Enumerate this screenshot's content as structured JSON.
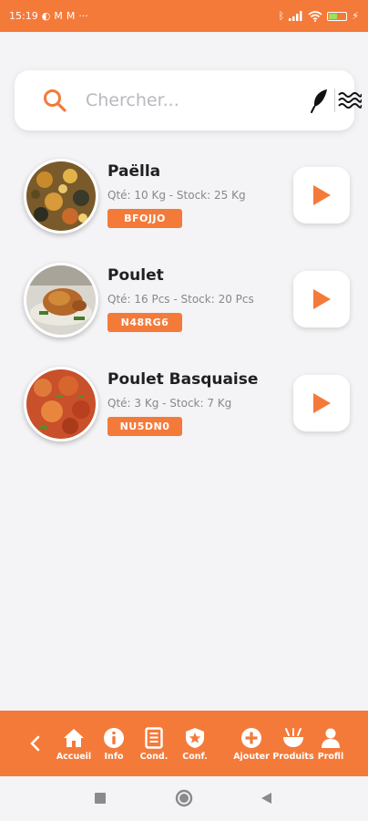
{
  "status_bar": {
    "time": "15:19",
    "dots": "···"
  },
  "search": {
    "placeholder": "Chercher..."
  },
  "products": [
    {
      "name": "Paëlla",
      "meta": "Qté: 10 Kg - Stock: 25 Kg",
      "code": "BFOJJO"
    },
    {
      "name": "Poulet",
      "meta": "Qté: 16 Pcs - Stock: 20 Pcs",
      "code": "N48RG6"
    },
    {
      "name": "Poulet Basquaise",
      "meta": "Qté: 3 Kg - Stock: 7 Kg",
      "code": "NU5DN0"
    }
  ],
  "bottom_nav": {
    "items": [
      {
        "label": "Accueil",
        "icon": "home-icon"
      },
      {
        "label": "Info",
        "icon": "info-icon"
      },
      {
        "label": "Cond.",
        "icon": "document-icon"
      },
      {
        "label": "Conf.",
        "icon": "shield-star-icon"
      },
      {
        "label": "Ajouter",
        "icon": "add-circle-icon"
      },
      {
        "label": "Produits",
        "icon": "bowl-icon"
      },
      {
        "label": "Profil",
        "icon": "person-icon"
      }
    ]
  },
  "colors": {
    "accent": "#f47a3a",
    "background": "#f4f4f6",
    "card": "#ffffff"
  }
}
